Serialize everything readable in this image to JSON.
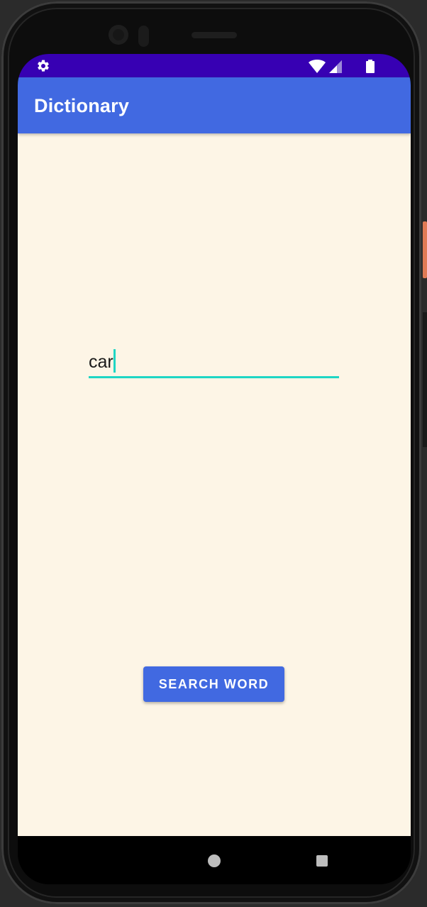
{
  "status_bar": {
    "background": "#3700b3",
    "left_icon": "settings-gear-icon",
    "right_icons": [
      "wifi-icon",
      "cellular-signal-icon",
      "battery-icon"
    ]
  },
  "app_bar": {
    "title": "Dictionary",
    "background": "#4169e1"
  },
  "content": {
    "background": "#fdf5e6",
    "word_input": {
      "value": "car",
      "underline_color": "#1ed6c4"
    },
    "search_button": {
      "label": "SEARCH WORD",
      "background": "#4169e1"
    }
  },
  "nav_bar": {
    "buttons": [
      "home-button",
      "recents-button"
    ]
  }
}
